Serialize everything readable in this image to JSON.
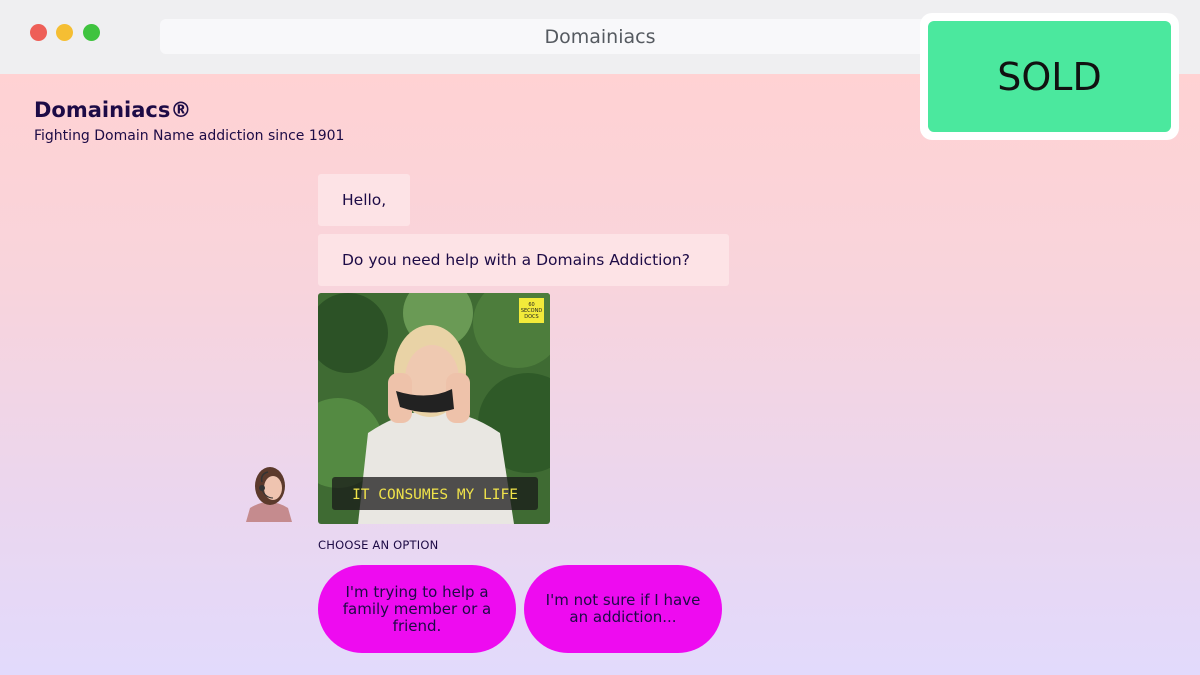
{
  "window": {
    "title": "Domainiacs"
  },
  "brand": {
    "name": "Domainiacs®",
    "tagline": "Fighting Domain Name addiction since 1901"
  },
  "chat": {
    "messages": [
      "Hello,",
      "Do you need help with a Domains Addiction?"
    ],
    "gif": {
      "caption": "IT CONSUMES MY LIFE",
      "watermark_line1": "60",
      "watermark_line2": "SECOND",
      "watermark_line3": "DOCS"
    },
    "choose_label": "CHOOSE AN OPTION",
    "options": [
      "I'm trying to help a family member or a friend.",
      "I'm not sure if I have an addiction..."
    ]
  },
  "badge": {
    "label": "SOLD"
  },
  "colors": {
    "option_bg": "#ee0bf0",
    "sold_bg": "#4be89e",
    "text_dark": "#1d0b46"
  }
}
